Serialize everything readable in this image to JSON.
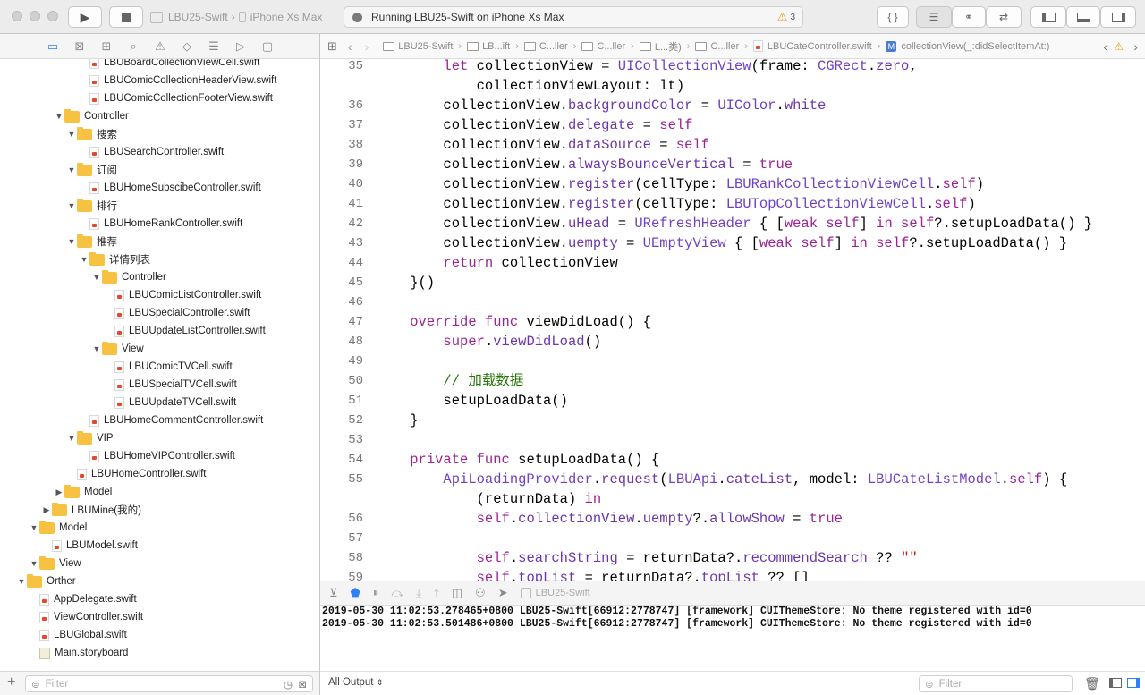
{
  "toolbar": {
    "scheme_project": "LBU25-Swift",
    "scheme_device": "iPhone Xs Max",
    "status_text": "Running LBU25-Swift on iPhone Xs Max",
    "warning_count": "3",
    "code_snippet_glyph": "{ }"
  },
  "navigator": {
    "tree": [
      {
        "label": "LBUBoardCollectionViewCell.swift",
        "type": "swift",
        "depth": 6
      },
      {
        "label": "LBUComicCollectionHeaderView.swift",
        "type": "swift",
        "depth": 6
      },
      {
        "label": "LBUComicCollectionFooterView.swift",
        "type": "swift",
        "depth": 6
      },
      {
        "label": "Controller",
        "type": "folder",
        "depth": 4,
        "open": true
      },
      {
        "label": "搜索",
        "type": "folder",
        "depth": 5,
        "open": true
      },
      {
        "label": "LBUSearchController.swift",
        "type": "swift",
        "depth": 6
      },
      {
        "label": "订阅",
        "type": "folder",
        "depth": 5,
        "open": true
      },
      {
        "label": "LBUHomeSubscibeController.swift",
        "type": "swift",
        "depth": 6
      },
      {
        "label": "排行",
        "type": "folder",
        "depth": 5,
        "open": true
      },
      {
        "label": "LBUHomeRankController.swift",
        "type": "swift",
        "depth": 6
      },
      {
        "label": "推荐",
        "type": "folder",
        "depth": 5,
        "open": true
      },
      {
        "label": "详情列表",
        "type": "folder",
        "depth": 6,
        "open": true
      },
      {
        "label": "Controller",
        "type": "folder",
        "depth": 7,
        "open": true
      },
      {
        "label": "LBUComicListController.swift",
        "type": "swift",
        "depth": 8
      },
      {
        "label": "LBUSpecialController.swift",
        "type": "swift",
        "depth": 8
      },
      {
        "label": "LBUUpdateListController.swift",
        "type": "swift",
        "depth": 8
      },
      {
        "label": "View",
        "type": "folder",
        "depth": 7,
        "open": true
      },
      {
        "label": "LBUComicTVCell.swift",
        "type": "swift",
        "depth": 8
      },
      {
        "label": "LBUSpecialTVCell.swift",
        "type": "swift",
        "depth": 8
      },
      {
        "label": "LBUUpdateTVCell.swift",
        "type": "swift",
        "depth": 8
      },
      {
        "label": "LBUHomeCommentController.swift",
        "type": "swift",
        "depth": 6
      },
      {
        "label": "VIP",
        "type": "folder",
        "depth": 5,
        "open": true
      },
      {
        "label": "LBUHomeVIPController.swift",
        "type": "swift",
        "depth": 6
      },
      {
        "label": "LBUHomeController.swift",
        "type": "swift",
        "depth": 5
      },
      {
        "label": "Model",
        "type": "folder",
        "depth": 4,
        "open": false
      },
      {
        "label": "LBUMine(我的)",
        "type": "folder",
        "depth": 3,
        "open": false
      },
      {
        "label": "Model",
        "type": "folder",
        "depth": 2,
        "open": true
      },
      {
        "label": "LBUModel.swift",
        "type": "swift",
        "depth": 3
      },
      {
        "label": "View",
        "type": "folder",
        "depth": 2,
        "open": true
      },
      {
        "label": "Orther",
        "type": "folder",
        "depth": 1,
        "open": true
      },
      {
        "label": "AppDelegate.swift",
        "type": "swift",
        "depth": 2
      },
      {
        "label": "ViewController.swift",
        "type": "swift",
        "depth": 2
      },
      {
        "label": "LBUGlobal.swift",
        "type": "swift",
        "depth": 2
      },
      {
        "label": "Main.storyboard",
        "type": "storyboard",
        "depth": 2
      }
    ],
    "filter_placeholder": "Filter"
  },
  "jumpbar": {
    "crumbs": [
      "LBU25-Swift",
      "LB...ift",
      "C...ller",
      "C...ller",
      "L...类)",
      "C...ller",
      "LBUCateController.swift"
    ],
    "method": "collectionView(_:didSelectItemAt:)"
  },
  "editor": {
    "lines": [
      {
        "n": "35",
        "html": "    <span class=\"kw\">let</span> collectionView = <span class=\"cls\">UICollectionView</span>(frame: <span class=\"cls\">CGRect</span>.<span class=\"prop\">zero</span>,"
      },
      {
        "n": "",
        "html": "        collectionViewLayout: lt)"
      },
      {
        "n": "36",
        "html": "    collectionView.<span class=\"prop\">backgroundColor</span> = <span class=\"cls\">UIColor</span>.<span class=\"prop\">white</span>"
      },
      {
        "n": "37",
        "html": "    collectionView.<span class=\"prop\">delegate</span> = <span class=\"kw\">self</span>"
      },
      {
        "n": "38",
        "html": "    collectionView.<span class=\"prop\">dataSource</span> = <span class=\"kw\">self</span>"
      },
      {
        "n": "39",
        "html": "    collectionView.<span class=\"prop\">alwaysBounceVertical</span> = <span class=\"kw\">true</span>"
      },
      {
        "n": "40",
        "html": "    collectionView.<span class=\"prop\">register</span>(cellType: <span class=\"cls\">LBURankCollectionViewCell</span>.<span class=\"kw\">self</span>)"
      },
      {
        "n": "41",
        "html": "    collectionView.<span class=\"prop\">register</span>(cellType: <span class=\"cls\">LBUTopCollectionViewCell</span>.<span class=\"kw\">self</span>)"
      },
      {
        "n": "42",
        "html": "    collectionView.<span class=\"prop\">uHead</span> = <span class=\"cls\">URefreshHeader</span> { [<span class=\"kw\">weak self</span>] <span class=\"kw\">in self</span>?.setupLoadData() }"
      },
      {
        "n": "43",
        "html": "    collectionView.<span class=\"prop\">uempty</span> = <span class=\"cls\">UEmptyView</span> { [<span class=\"kw\">weak self</span>] <span class=\"kw\">in self</span>?.setupLoadData() }"
      },
      {
        "n": "44",
        "html": "    <span class=\"kw\">return</span> collectionView"
      },
      {
        "n": "45",
        "html": "}()"
      },
      {
        "n": "46",
        "html": ""
      },
      {
        "n": "47",
        "html": "<span class=\"kw\">override func</span> viewDidLoad() {"
      },
      {
        "n": "48",
        "html": "    <span class=\"kw\">super</span>.<span class=\"prop\">viewDidLoad</span>()"
      },
      {
        "n": "49",
        "html": ""
      },
      {
        "n": "50",
        "html": "    <span class=\"cm\">// 加载数据</span>"
      },
      {
        "n": "51",
        "html": "    setupLoadData()"
      },
      {
        "n": "52",
        "html": "}"
      },
      {
        "n": "53",
        "html": ""
      },
      {
        "n": "54",
        "html": "<span class=\"kw\">private func</span> setupLoadData() {"
      },
      {
        "n": "55",
        "html": "    <span class=\"cls\">ApiLoadingProvider</span>.<span class=\"prop\">request</span>(<span class=\"cls\">LBUApi</span>.<span class=\"prop\">cateList</span>, model: <span class=\"cls\">LBUCateListModel</span>.<span class=\"kw\">self</span>) {"
      },
      {
        "n": "",
        "html": "        (returnData) <span class=\"kw\">in</span>"
      },
      {
        "n": "56",
        "html": "        <span class=\"kw\">self</span>.<span class=\"prop\">collectionView</span>.<span class=\"prop\">uempty</span>?.<span class=\"prop\">allowShow</span> = <span class=\"kw\">true</span>"
      },
      {
        "n": "57",
        "html": ""
      },
      {
        "n": "58",
        "html": "        <span class=\"kw\">self</span>.<span class=\"prop\">searchString</span> = returnData?.<span class=\"prop\">recommendSearch</span> ?? <span class=\"st\">\"\"</span>"
      },
      {
        "n": "59",
        "html": "        <span class=\"kw\">self</span>.<span class=\"prop\">topList</span> = returnData?.<span class=\"prop\">topList</span> ?? []"
      }
    ]
  },
  "debug": {
    "process": "LBU25-Swift"
  },
  "console": {
    "lines": [
      "2019-05-30 11:02:53.278465+0800 LBU25-Swift[66912:2778747] [framework] CUIThemeStore: No theme registered with id=0",
      "2019-05-30 11:02:53.501486+0800 LBU25-Swift[66912:2778747] [framework] CUIThemeStore: No theme registered with id=0"
    ],
    "output_selector": "All Output",
    "filter_placeholder": "Filter"
  }
}
